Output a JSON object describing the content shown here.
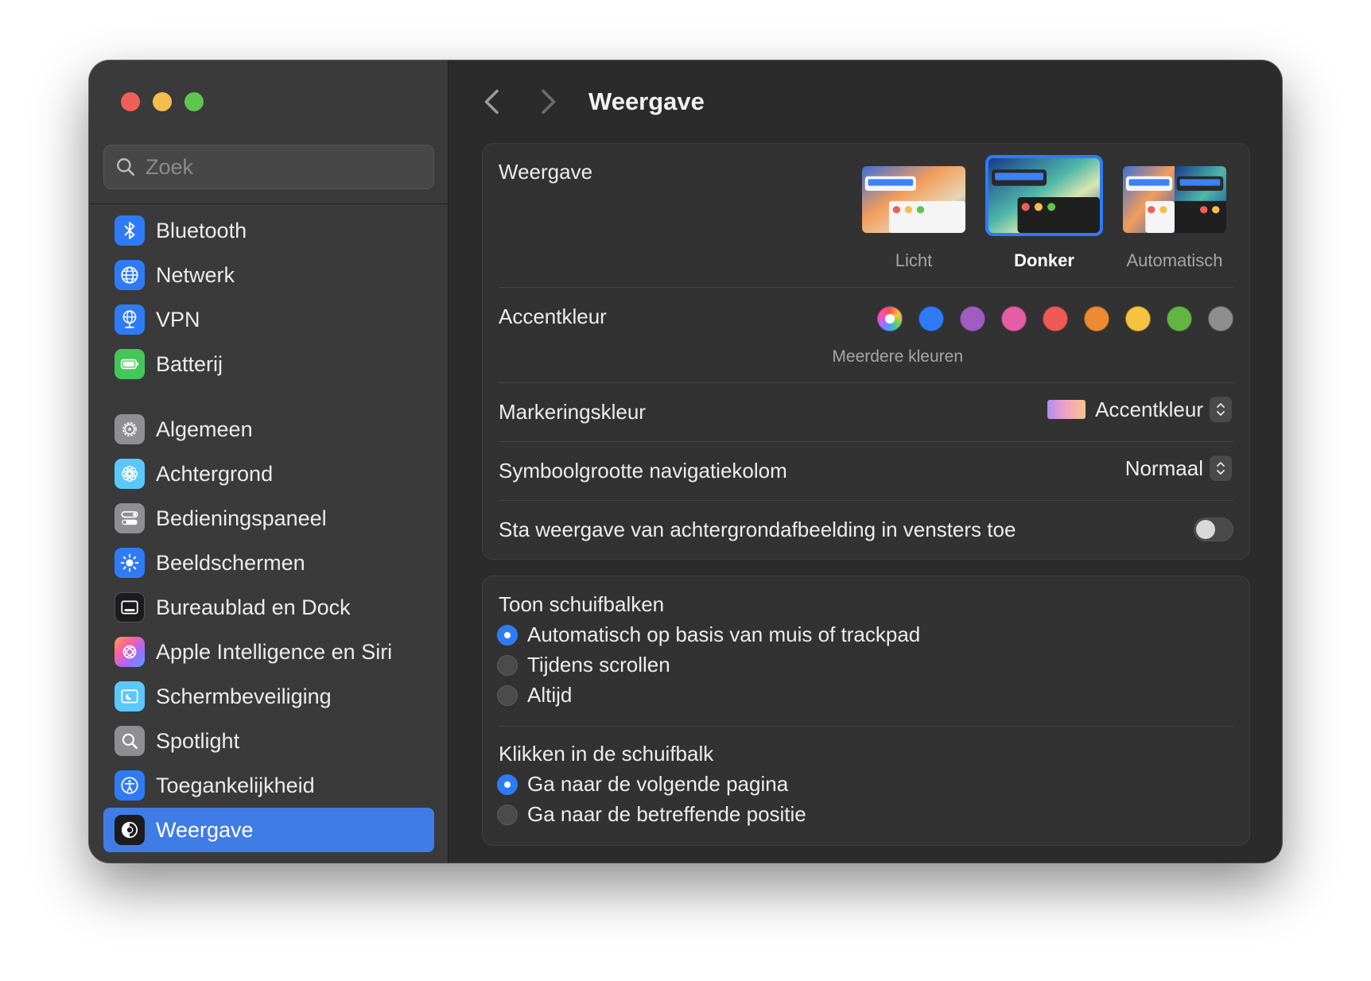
{
  "window": {
    "traffic_lights": [
      "close",
      "minimize",
      "zoom"
    ]
  },
  "sidebar": {
    "search": {
      "placeholder": "Zoek",
      "value": ""
    },
    "items": [
      {
        "label": "Bluetooth",
        "icon": "bluetooth-icon",
        "color": "#2f7bf6"
      },
      {
        "label": "Netwerk",
        "icon": "globe-icon",
        "color": "#2f7bf6"
      },
      {
        "label": "VPN",
        "icon": "vpn-globe-icon",
        "color": "#2f7bf6"
      },
      {
        "label": "Batterij",
        "icon": "battery-icon",
        "color": "#43c759"
      },
      {
        "label": "Algemeen",
        "icon": "gear-icon",
        "color": "#8e8e93"
      },
      {
        "label": "Achtergrond",
        "icon": "flower-icon",
        "color": "#5ac8fa"
      },
      {
        "label": "Bedieningspaneel",
        "icon": "toggles-icon",
        "color": "#8e8e93"
      },
      {
        "label": "Beeldschermen",
        "icon": "sun-icon",
        "color": "#2f7bf6"
      },
      {
        "label": "Bureaublad en Dock",
        "icon": "dock-icon",
        "color": "#1c1c1e"
      },
      {
        "label": "Apple Intelligence en Siri",
        "icon": "siri-icon",
        "color": "#ff7a59"
      },
      {
        "label": "Schermbeveiliging",
        "icon": "screensaver-icon",
        "color": "#5ac8fa"
      },
      {
        "label": "Spotlight",
        "icon": "magnifier-icon",
        "color": "#8e8e93"
      },
      {
        "label": "Toegankelijkheid",
        "icon": "accessibility-icon",
        "color": "#2f7bf6"
      },
      {
        "label": "Weergave",
        "icon": "appearance-icon",
        "color": "#1c1c1e",
        "active": true
      }
    ]
  },
  "toolbar": {
    "back_icon": "chevron-left-icon",
    "forward_icon": "chevron-right-icon",
    "title": "Weergave"
  },
  "appearance": {
    "label": "Weergave",
    "options": [
      {
        "label": "Licht",
        "selected": false
      },
      {
        "label": "Donker",
        "selected": true
      },
      {
        "label": "Automatisch",
        "selected": false
      }
    ]
  },
  "accent": {
    "label": "Accentkleur",
    "caption": "Meerdere kleuren",
    "swatches": [
      "multicolor",
      "#2f7bf6",
      "#a15cc2",
      "#e35ea4",
      "#ee5a55",
      "#ed8a34",
      "#f6c340",
      "#62b543",
      "#8e8e8e"
    ],
    "selected": "multicolor"
  },
  "highlight": {
    "label": "Markeringskleur",
    "value": "Accentkleur"
  },
  "sidebar_icon_size": {
    "label": "Symboolgrootte navigatiekolom",
    "value": "Normaal"
  },
  "wallpaper_tinting": {
    "label": "Sta weergave van achtergrondafbeelding in vensters toe",
    "enabled": false
  },
  "scrollbars": {
    "title": "Toon schuifbalken",
    "options": [
      {
        "label": "Automatisch op basis van muis of trackpad",
        "selected": true
      },
      {
        "label": "Tijdens scrollen",
        "selected": false
      },
      {
        "label": "Altijd",
        "selected": false
      }
    ]
  },
  "click_scrollbar": {
    "title": "Klikken in de schuifbalk",
    "options": [
      {
        "label": "Ga naar de volgende pagina",
        "selected": true
      },
      {
        "label": "Ga naar de betreffende positie",
        "selected": false
      }
    ]
  }
}
